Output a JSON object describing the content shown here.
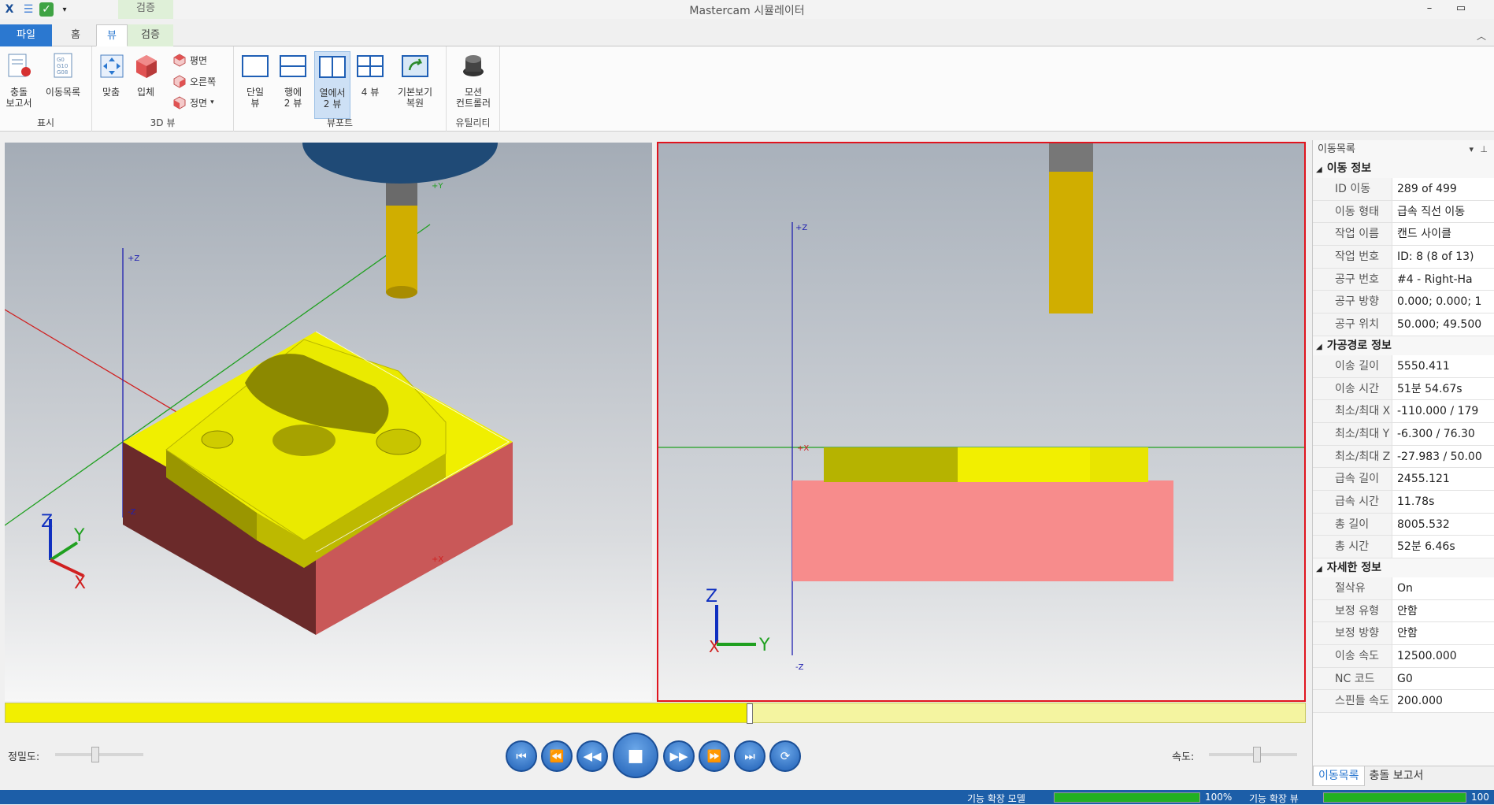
{
  "window": {
    "title": "Mastercam 시뮬레이터",
    "context_tab": "검증",
    "minimize": "–",
    "restore": "▭"
  },
  "tabs": {
    "file": "파일",
    "home": "홈",
    "view": "뷰",
    "verify": "검증"
  },
  "ribbon": {
    "groups": {
      "display": "표시",
      "view3d": "3D 뷰",
      "viewport": "뷰포트",
      "utility": "유틸리티"
    },
    "collision_report": [
      "충돌",
      "보고서"
    ],
    "move_list": "이동목록",
    "fit": "맞춤",
    "solid": "입체",
    "plan": "평면",
    "right": "오른쪽",
    "front": "정면",
    "single_view": [
      "단일",
      "뷰"
    ],
    "two_rows": [
      "행에",
      "2 뷰"
    ],
    "two_cols": [
      "열에서",
      "2 뷰"
    ],
    "four_view": "4 뷰",
    "restore_default": [
      "기본보기",
      "복원"
    ],
    "motion_controller": [
      "모션",
      "컨트롤러"
    ]
  },
  "viewports": {
    "left": {
      "axis": {
        "y": "+Y",
        "z": "+Z",
        "zneg": "-Z",
        "x": "+X"
      },
      "triad": {
        "z": "Z",
        "y": "Y",
        "x": "X"
      }
    },
    "right": {
      "axis": {
        "z": "+Z",
        "zneg": "-Z",
        "x": "+X"
      },
      "triad": {
        "z": "Z",
        "y": "Y",
        "x": "X"
      }
    }
  },
  "playback": {
    "precision_label": "정밀도:",
    "speed_label": "속도:",
    "precision_level": 0.45,
    "speed_level": 0.55,
    "timeline_progress": 0.573,
    "buttons": {
      "first": "⏮",
      "prev_step": "⏪",
      "rewind": "◀◀",
      "stop": "■",
      "forward": "▶▶",
      "next_step": "⏩",
      "last": "⏭",
      "loop": "⟳"
    }
  },
  "panel": {
    "title": "이동목록",
    "sections": {
      "move": "이동 정보",
      "toolpath": "가공경로 정보",
      "detail": "자세한 정보"
    },
    "move_rows": [
      {
        "k": "ID 이동",
        "v": "289 of 499"
      },
      {
        "k": "이동 형태",
        "v": "급속 직선 이동"
      },
      {
        "k": "작업 이름",
        "v": "캔드 사이클"
      },
      {
        "k": "작업 번호",
        "v": "ID: 8 (8 of 13)"
      },
      {
        "k": "공구 번호",
        "v": "#4 -  Right-Ha"
      },
      {
        "k": "공구 방향",
        "v": "0.000; 0.000; 1"
      },
      {
        "k": "공구 위치",
        "v": "50.000; 49.500"
      }
    ],
    "toolpath_rows": [
      {
        "k": "이송 길이",
        "v": "5550.411"
      },
      {
        "k": "이송 시간",
        "v": "51분 54.67s"
      },
      {
        "k": "최소/최대 X",
        "v": "-110.000 / 179"
      },
      {
        "k": "최소/최대 Y",
        "v": "-6.300 / 76.30"
      },
      {
        "k": "최소/최대 Z",
        "v": "-27.983 / 50.00"
      },
      {
        "k": "급속 길이",
        "v": "2455.121"
      },
      {
        "k": "급속 시간",
        "v": "11.78s"
      },
      {
        "k": "총 길이",
        "v": "8005.532"
      },
      {
        "k": "총 시간",
        "v": "52분 6.46s"
      }
    ],
    "detail_rows": [
      {
        "k": "절삭유",
        "v": "On"
      },
      {
        "k": "보정 유형",
        "v": "안함"
      },
      {
        "k": "보정 방향",
        "v": "안함"
      },
      {
        "k": "이송 속도",
        "v": "12500.000"
      },
      {
        "k": "NC 코드",
        "v": "G0"
      },
      {
        "k": "스핀들 속도",
        "v": "200.000"
      }
    ],
    "tabs": {
      "move_list": "이동목록",
      "collision": "충돌 보고서"
    }
  },
  "status": {
    "label1": "기능 확장 모델",
    "pct1": "100%",
    "label2": "기능 확장 뷰",
    "pct2": "100",
    "level1": 1.0,
    "level2": 1.0
  },
  "colors": {
    "accent": "#2b78d0",
    "stock_top": "#f0ef00",
    "stock_side": "#c65a5a",
    "tool_shank": "#c8a800",
    "holder": "#1e4a78",
    "active_border": "#e0141e"
  }
}
